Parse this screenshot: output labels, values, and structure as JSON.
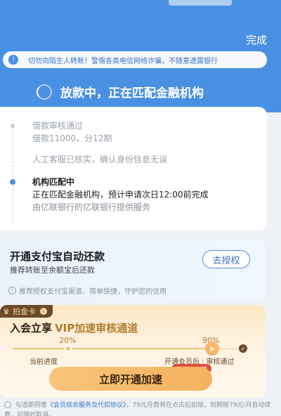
{
  "header": {
    "done_label": "完成",
    "warning": "切勿向陌生人转账！警惕各类电信网络诈骗，不随意透露银行",
    "status": "放款中，正在匹配金融机构"
  },
  "progress": {
    "steps": [
      {
        "line1": "借款审核通过",
        "line2": "借款11000，分12期"
      },
      {
        "line1": "人工客服已核实，确认身份信息无误"
      },
      {
        "line1": "机构匹配中",
        "line2": "正在匹配金融机构，预计申请次日12:00前完成",
        "line3": "由亿联银行的亿联银行提供服务"
      }
    ]
  },
  "alipay": {
    "title": "开通支付宝自动还款",
    "subtitle": "推荐转账至余额宝后还款",
    "button": "去授权",
    "note": "推荐授权支付宝渠道，简单快捷，守护您的信用"
  },
  "vip": {
    "badge": "拍金卡",
    "badge_info": "i",
    "title_prefix": "入会立享",
    "title_accent": "VIP加速审核通道",
    "pct_current": "20%",
    "pct_target": "90%",
    "stage_current": "当前进度",
    "stage_member": "开通会员后",
    "stage_sep": "|",
    "stage_done": "审核通过",
    "red_tag": "借不到立赔",
    "button": "立即开通加速"
  },
  "agreement": {
    "prefix": "勾选即同意",
    "link": "《会员综合服务及代扣协议》",
    "suffix": "，79元月费将在点击后扣除，到期按79元/月自动续费，可随时取消。"
  },
  "icons": {
    "warning": "bell-icon",
    "status": "spinner-icon",
    "info": "info-icon",
    "crown": "crown-icon",
    "fast": "rocket-icon",
    "check": "check-icon"
  },
  "colors": {
    "primary": "#4a90e2",
    "gold": "#f4b25d",
    "red": "#e14b3b"
  }
}
